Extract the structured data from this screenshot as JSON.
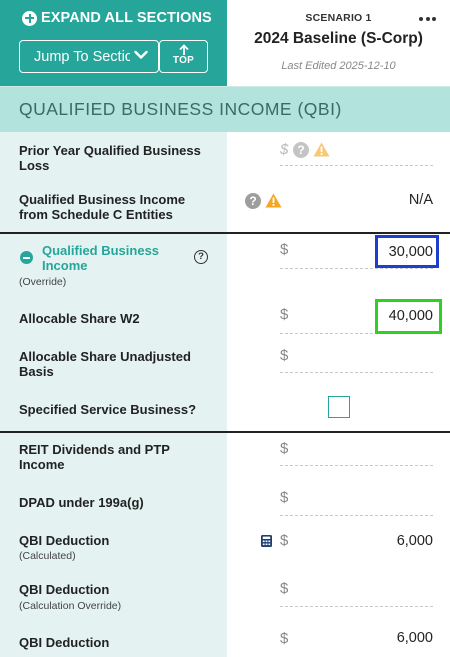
{
  "header": {
    "expand_all_label": "EXPAND ALL SECTIONS",
    "jump_select_value": "Jump To Section",
    "top_button_label": "TOP",
    "scenario_number": "SCENARIO 1",
    "scenario_name": "2024 Baseline (S-Corp)",
    "last_edited": "Last Edited 2025-12-10",
    "more_icon": "more-horizontal-icon"
  },
  "section": {
    "title": "QUALIFIED BUSINESS INCOME (QBI)"
  },
  "currency_symbol": "$",
  "fields": {
    "prior_year_loss": {
      "label": "Prior Year Qualified Business Loss"
    },
    "qbi_schedule_c": {
      "label": "Qualified Business Income from Schedule C Entities",
      "value": "N/A"
    },
    "qbi": {
      "label": "Qualified Business Income",
      "sublabel": "(Override)",
      "value": "30,000"
    },
    "w2": {
      "label": "Allocable Share W2",
      "value": "40,000"
    },
    "ubia": {
      "label": "Allocable Share Unadjusted Basis"
    },
    "sstb": {
      "label": "Specified Service Business?",
      "checked": false
    },
    "reit": {
      "label": "REIT Dividends and PTP Income"
    },
    "dpad": {
      "label": "DPAD under 199a(g)"
    },
    "qbi_deduction_calc": {
      "label": "QBI Deduction",
      "sublabel": "(Calculated)",
      "value": "6,000"
    },
    "qbi_deduction_override": {
      "label": "QBI Deduction",
      "sublabel": "(Calculation Override)"
    },
    "qbi_deduction": {
      "label": "QBI Deduction",
      "value": "6,000"
    }
  },
  "icons": {
    "help": "?",
    "help_outline": "?"
  },
  "colors": {
    "teal": "#26a69a",
    "section_bg": "#b2e3dd",
    "label_bg": "#e4f3f1",
    "warning": "#f5a623",
    "highlight_blue": "#1e3fcc",
    "highlight_green": "#2fcf24"
  }
}
